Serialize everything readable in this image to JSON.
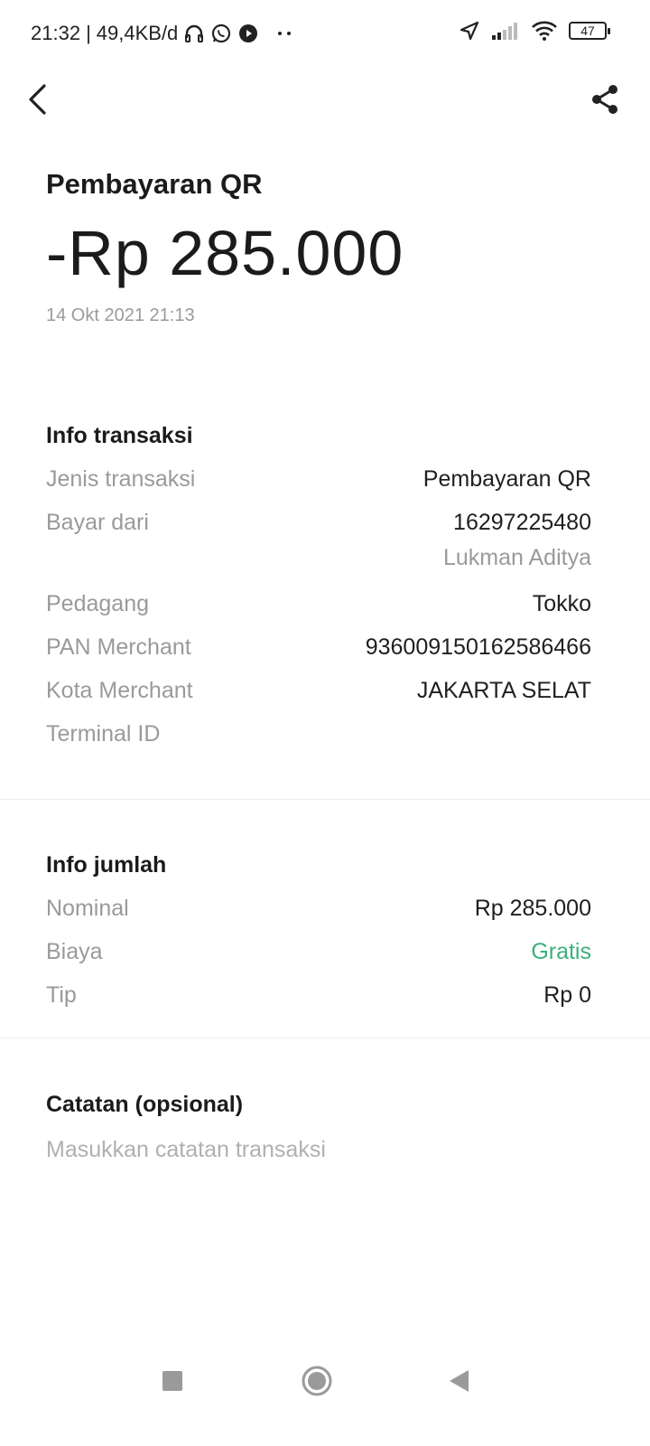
{
  "status_bar": {
    "time": "21:32",
    "network_speed": "49,4KB/d",
    "battery_level": "47",
    "icons": [
      "headphones-icon",
      "whatsapp-icon",
      "media-icon",
      "more-dots-icon",
      "location-icon",
      "signal-icon",
      "wifi-icon",
      "battery-icon"
    ]
  },
  "header": {
    "back_icon": "chevron-left-icon",
    "share_icon": "share-icon"
  },
  "summary": {
    "title": "Pembayaran QR",
    "amount": "-Rp 285.000",
    "datetime": "14 Okt 2021 21:13"
  },
  "transaction_info": {
    "title": "Info transaksi",
    "rows": [
      {
        "label": "Jenis transaksi",
        "value": "Pembayaran QR"
      },
      {
        "label": "Bayar dari",
        "value": "16297225480",
        "sub": "Lukman Aditya"
      },
      {
        "label": "Pedagang",
        "value": "Tokko"
      },
      {
        "label": "PAN Merchant",
        "value": "936009150162586466"
      },
      {
        "label": "Kota Merchant",
        "value": "JAKARTA SELAT"
      },
      {
        "label": "Terminal ID",
        "value": ""
      }
    ]
  },
  "amount_info": {
    "title": "Info jumlah",
    "rows": [
      {
        "label": "Nominal",
        "value": "Rp 285.000"
      },
      {
        "label": "Biaya",
        "value": "Gratis"
      },
      {
        "label": "Tip",
        "value": "Rp 0"
      }
    ]
  },
  "notes": {
    "title": "Catatan (opsional)",
    "placeholder": "Masukkan catatan transaksi",
    "value": ""
  },
  "colors": {
    "accent_green": "#3bb07a",
    "label_gray": "#9a9a9a",
    "text_dark": "#1b1b1b"
  },
  "nav_bar": {
    "icons": [
      "recent-apps-icon",
      "home-icon",
      "back-triangle-icon"
    ]
  }
}
